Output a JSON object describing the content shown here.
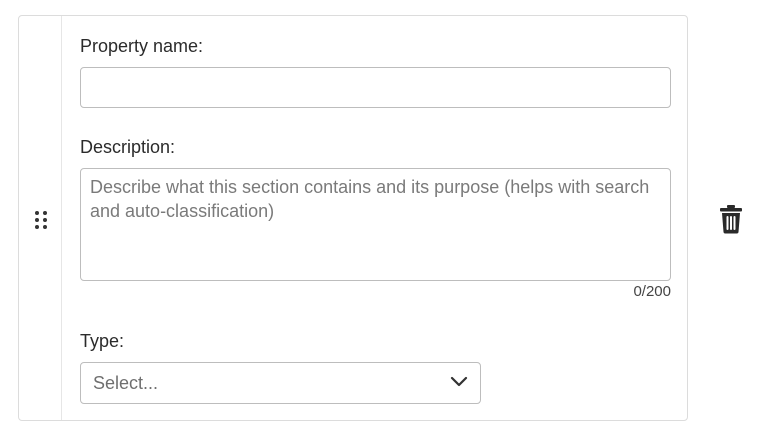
{
  "form": {
    "property_name": {
      "label": "Property name:",
      "value": "",
      "placeholder": ""
    },
    "description": {
      "label": "Description:",
      "value": "",
      "placeholder": "Describe what this section contains and its purpose (helps with search and auto-classification)",
      "char_count": "0/200"
    },
    "type": {
      "label": "Type:",
      "selected": "Select..."
    }
  },
  "icons": {
    "drag_handle": "drag-handle-icon",
    "chevron": "chevron-down-icon",
    "delete": "trash-icon"
  },
  "colors": {
    "border": "#bdbdbd",
    "card_border": "#dcdcdc",
    "placeholder": "#7a7a7a",
    "icon": "#222222"
  }
}
